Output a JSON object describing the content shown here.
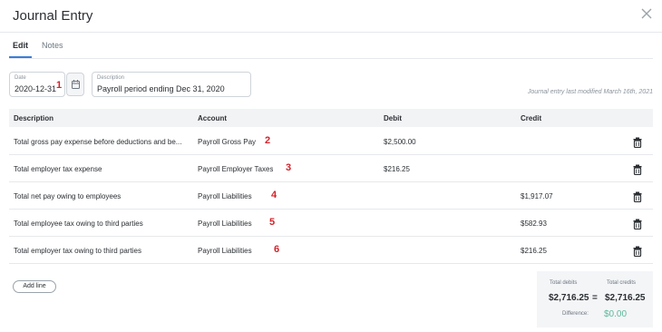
{
  "modal": {
    "title": "Journal Entry"
  },
  "tabs": [
    {
      "label": "Edit",
      "active": true
    },
    {
      "label": "Notes",
      "active": false
    }
  ],
  "date_field": {
    "label": "Date",
    "value": "2020-12-31"
  },
  "description_field": {
    "label": "Description",
    "value": "Payroll period ending Dec 31, 2020"
  },
  "modified_text": "Journal entry last modified March 16th, 2021",
  "table": {
    "headers": [
      "Description",
      "Account",
      "Debit",
      "Credit"
    ],
    "rows": [
      {
        "description": "Total gross pay expense before deductions and be...",
        "account": "Payroll Gross Pay",
        "debit": "$2,500.00",
        "credit": "",
        "annotation": "2"
      },
      {
        "description": "Total employer tax expense",
        "account": "Payroll Employer Taxes",
        "debit": "$216.25",
        "credit": "",
        "annotation": "3"
      },
      {
        "description": "Total net pay owing to employees",
        "account": "Payroll Liabilities",
        "debit": "",
        "credit": "$1,917.07",
        "annotation": "4"
      },
      {
        "description": "Total employee tax owing to third parties",
        "account": "Payroll Liabilities",
        "debit": "",
        "credit": "$582.93",
        "annotation": "5"
      },
      {
        "description": "Total employer tax owing to third parties",
        "account": "Payroll Liabilities",
        "debit": "",
        "credit": "$216.25",
        "annotation": "6"
      }
    ]
  },
  "annotations": {
    "date": "1"
  },
  "add_line_label": "Add line",
  "totals": {
    "debits_label": "Total debits",
    "credits_label": "Total credits",
    "debits_value": "$2,716.25",
    "credits_value": "$2,716.25",
    "equals": "=",
    "difference_label": "Difference:",
    "difference_value": "$0.00"
  },
  "colors": {
    "accent": "#3b7dd8",
    "annotation": "#d2232a",
    "difference": "#5bb89a"
  },
  "icons": {
    "close": "close-icon",
    "calendar": "calendar-icon",
    "delete": "trash-icon"
  }
}
